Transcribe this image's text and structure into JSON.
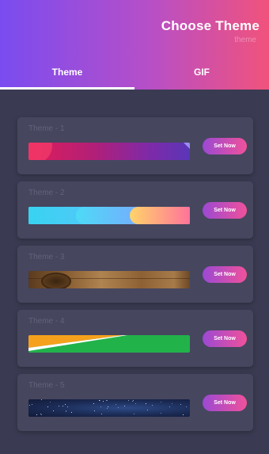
{
  "header": {
    "title": "Choose Theme",
    "subtitle": "theme"
  },
  "tabs": [
    {
      "label": "Theme",
      "active": true
    },
    {
      "label": "GIF",
      "active": false
    }
  ],
  "themes": [
    {
      "name": "Theme - 1",
      "button": "Set Now",
      "preview": "magenta-purple-gradient"
    },
    {
      "name": "Theme - 2",
      "button": "Set Now",
      "preview": "cyan-blue-orange-pink-gradient"
    },
    {
      "name": "Theme - 3",
      "button": "Set Now",
      "preview": "wood-texture"
    },
    {
      "name": "Theme - 4",
      "button": "Set Now",
      "preview": "orange-white-green-swoosh"
    },
    {
      "name": "Theme - 5",
      "button": "Set Now",
      "preview": "starry-night-sky"
    }
  ],
  "colors": {
    "background": "#3a3a52",
    "card": "#46465f",
    "header_start": "#7a4cf0",
    "header_end": "#f1527c"
  }
}
